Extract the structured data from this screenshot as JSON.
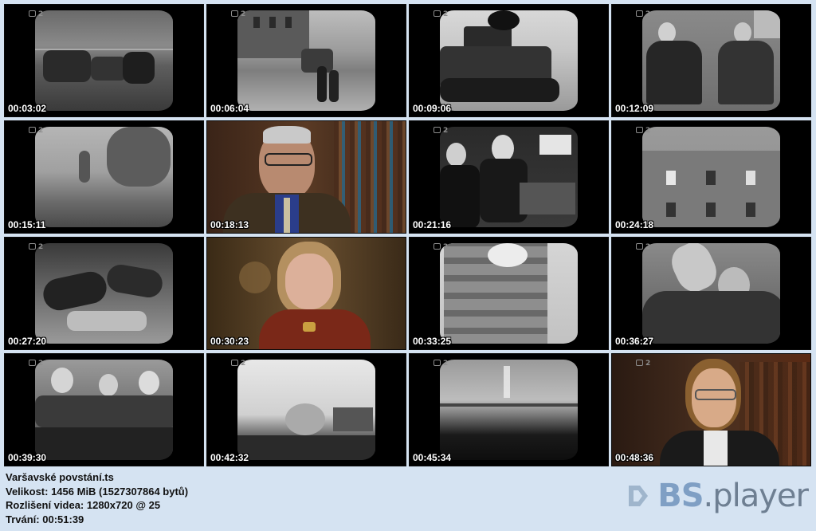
{
  "channel_logo": "2",
  "thumbnails": [
    {
      "timecode": "00:03:02"
    },
    {
      "timecode": "00:06:04"
    },
    {
      "timecode": "00:09:06"
    },
    {
      "timecode": "00:12:09"
    },
    {
      "timecode": "00:15:11"
    },
    {
      "timecode": "00:18:13"
    },
    {
      "timecode": "00:21:16"
    },
    {
      "timecode": "00:24:18"
    },
    {
      "timecode": "00:27:20"
    },
    {
      "timecode": "00:30:23"
    },
    {
      "timecode": "00:33:25"
    },
    {
      "timecode": "00:36:27"
    },
    {
      "timecode": "00:39:30"
    },
    {
      "timecode": "00:42:32"
    },
    {
      "timecode": "00:45:34"
    },
    {
      "timecode": "00:48:36"
    }
  ],
  "file_info": {
    "filename": "Varšavské povstání.ts",
    "size": "Velikost: 1456 MiB (1527307864 bytů)",
    "resolution": "Rozlišení videa: 1280x720 @ 25",
    "duration": "Trvání: 00:51:39"
  },
  "brand": {
    "bs": "BS",
    "player": ".player",
    "icon": "bs-player-logo-icon"
  }
}
